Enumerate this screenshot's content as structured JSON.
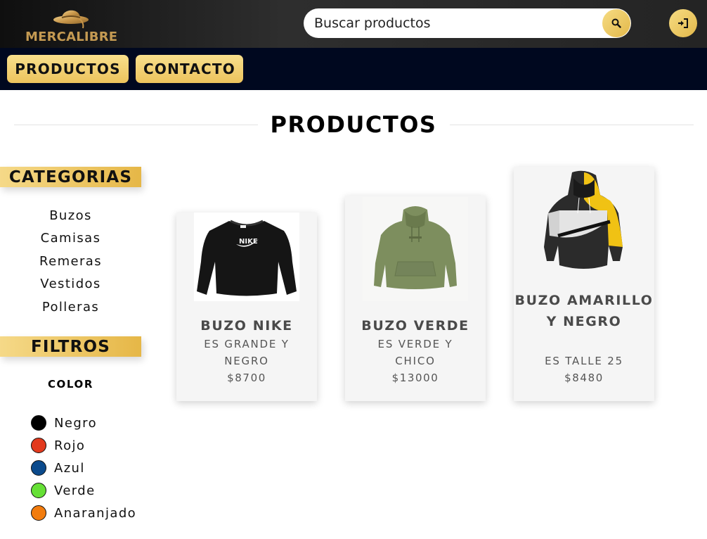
{
  "header": {
    "brand": "MERCALIBRE",
    "search_placeholder": "Buscar productos"
  },
  "nav": {
    "productos": "PRODUCTOS",
    "contacto": "CONTACTO"
  },
  "page": {
    "title": "PRODUCTOS"
  },
  "sidebar": {
    "categories_title": "CATEGORIAS",
    "categories": [
      "Buzos",
      "Camisas",
      "Remeras",
      "Vestidos",
      "Polleras"
    ],
    "filters_title": "FILTROS",
    "color_label": "COLOR",
    "colors": [
      {
        "name": "Negro",
        "hex": "#000000"
      },
      {
        "name": "Rojo",
        "hex": "#e23a1e"
      },
      {
        "name": "Azul",
        "hex": "#0b4a8c"
      },
      {
        "name": "Verde",
        "hex": "#66e036"
      },
      {
        "name": "Anaranjado",
        "hex": "#f27c0e"
      }
    ]
  },
  "products": [
    {
      "name": "BUZO NIKE",
      "desc": "ES GRANDE Y NEGRO",
      "price": "$8700"
    },
    {
      "name": "BUZO VERDE",
      "desc": "ES VERDE Y CHICO",
      "price": "$13000"
    },
    {
      "name": "BUZO AMARILLO Y NEGRO",
      "desc": "ES TALLE 25",
      "price": "$8480"
    }
  ],
  "icons": {
    "logo": "sun-hat-logo-icon",
    "search": "search-icon",
    "login": "sign-in-icon"
  },
  "colors": {
    "gold": "#ecc35d",
    "navbar": "#00081f",
    "topbar": "#242424"
  }
}
